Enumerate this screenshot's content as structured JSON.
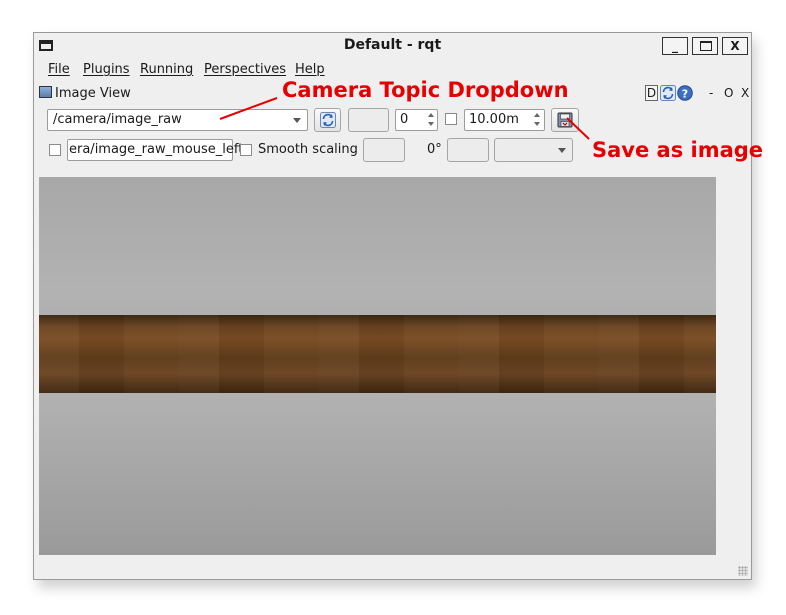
{
  "window": {
    "title": "Default - rqt"
  },
  "window_buttons": {
    "minimize": "_",
    "maximize": "□",
    "close": "X"
  },
  "menubar": {
    "items": [
      "File",
      "Plugins",
      "Running",
      "Perspectives",
      "Help"
    ]
  },
  "dock": {
    "title": "Image View",
    "buttons": {
      "d_label": "D",
      "minimize": "-",
      "float": "O",
      "close": "X"
    }
  },
  "toolbar": {
    "topic_value": "/camera/image_raw",
    "spin_value": "0",
    "duration_value": "10.00m",
    "mouse_topic_value": "era/image_raw_mouse_left",
    "smooth_scaling_label": "Smooth scaling",
    "rotation_label": "0°"
  },
  "annotations": {
    "camera_topic": "Camera Topic Dropdown",
    "save_image": "Save as image"
  },
  "colors": {
    "annotation_red": "#e60000"
  },
  "icons": [
    "app-window-icon",
    "image-view-icon",
    "refresh-icon",
    "help-icon",
    "save-image-icon",
    "chevron-down-icon",
    "spin-up-icon",
    "spin-down-icon"
  ]
}
